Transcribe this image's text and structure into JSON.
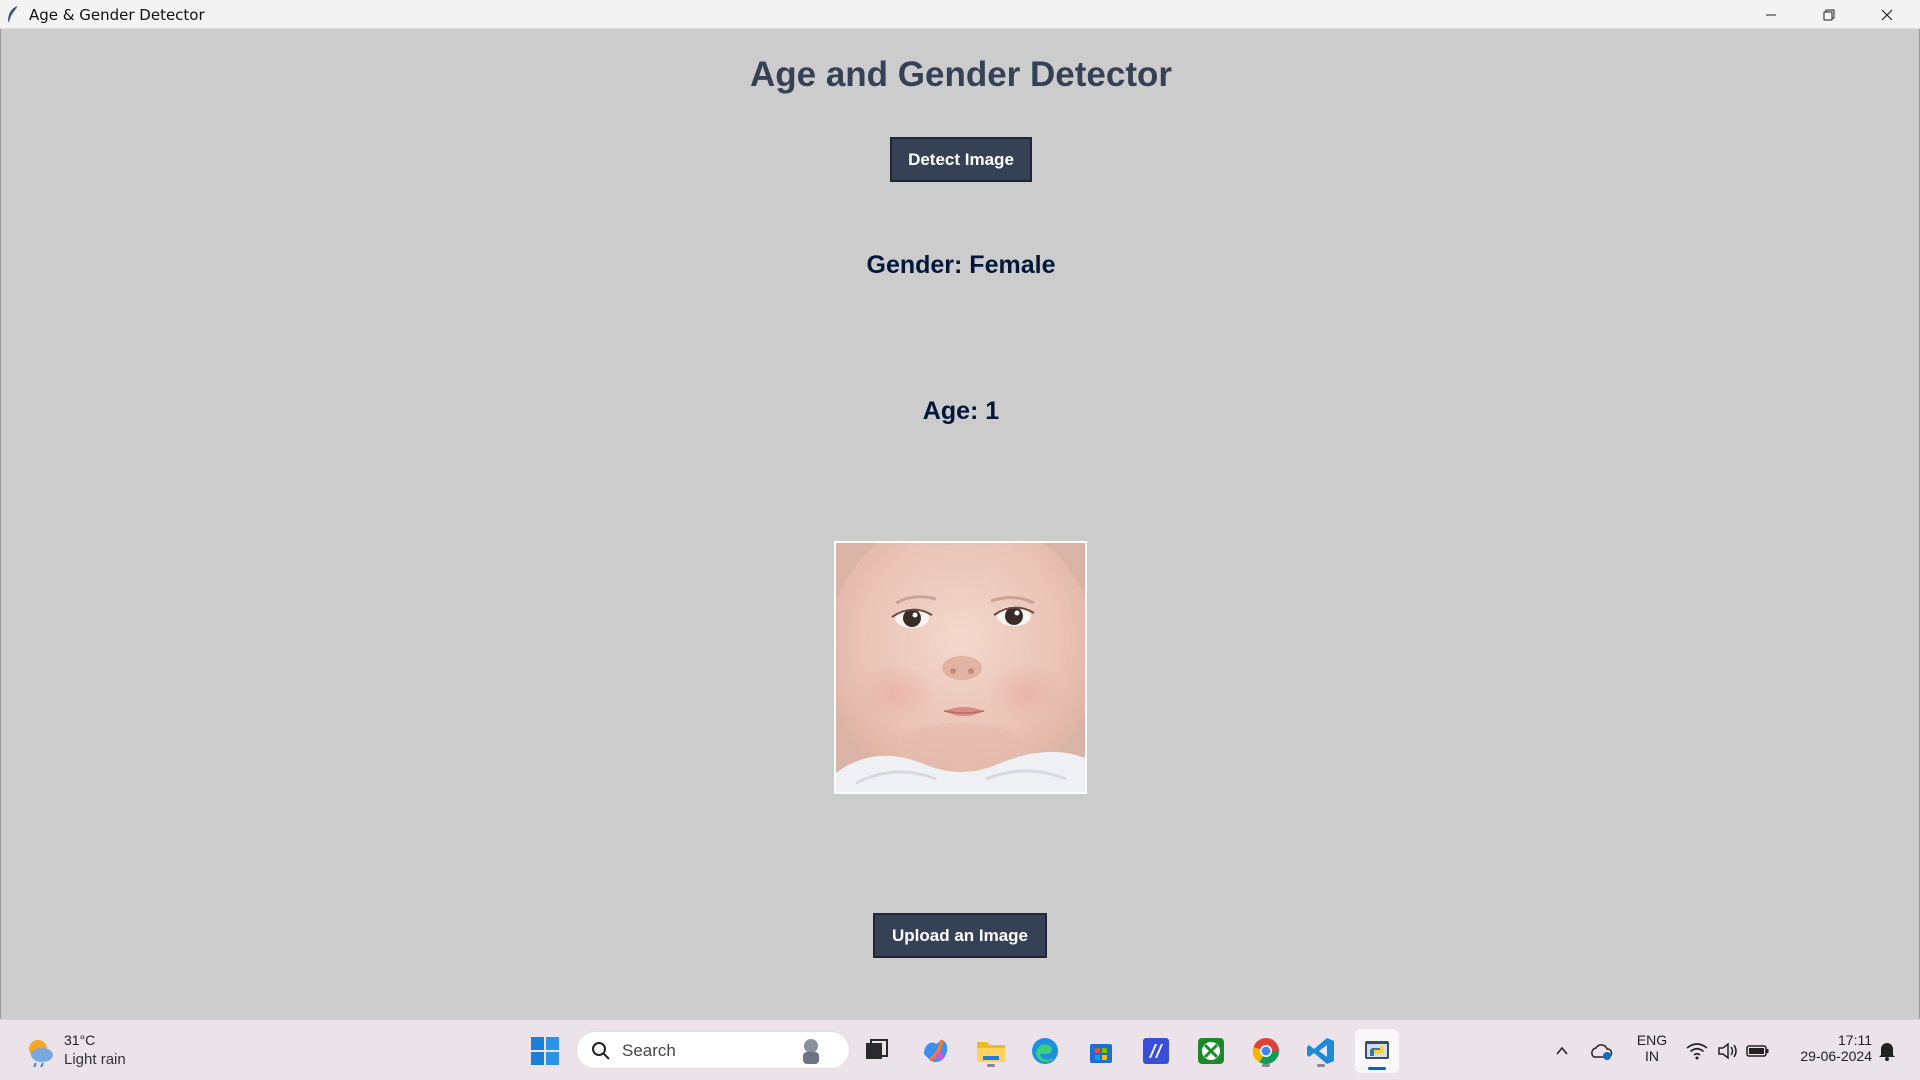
{
  "window": {
    "title": "Age & Gender Detector"
  },
  "app": {
    "heading": "Age and Gender Detector",
    "detect_button": "Detect Image",
    "gender_result": "Gender: Female",
    "age_result": "Age: 1",
    "upload_button": "Upload an Image",
    "colors": {
      "background": "#cccccc",
      "heading": "#364156",
      "button": "#364156",
      "result_text": "#011638"
    }
  },
  "taskbar": {
    "weather": {
      "temp": "31°C",
      "condition": "Light rain",
      "icon": "weather-rain-icon"
    },
    "search_placeholder": "Search",
    "pinned": [
      "start-icon",
      "search-icon",
      "task-view-icon",
      "copilot-icon",
      "file-explorer-icon",
      "edge-icon",
      "store-icon",
      "app-icon",
      "xbox-icon",
      "chrome-icon",
      "vscode-icon",
      "python-tkinter-icon"
    ],
    "tray": {
      "language_top": "ENG",
      "language_bottom": "IN",
      "time": "17:11",
      "date": "29-06-2024"
    }
  }
}
